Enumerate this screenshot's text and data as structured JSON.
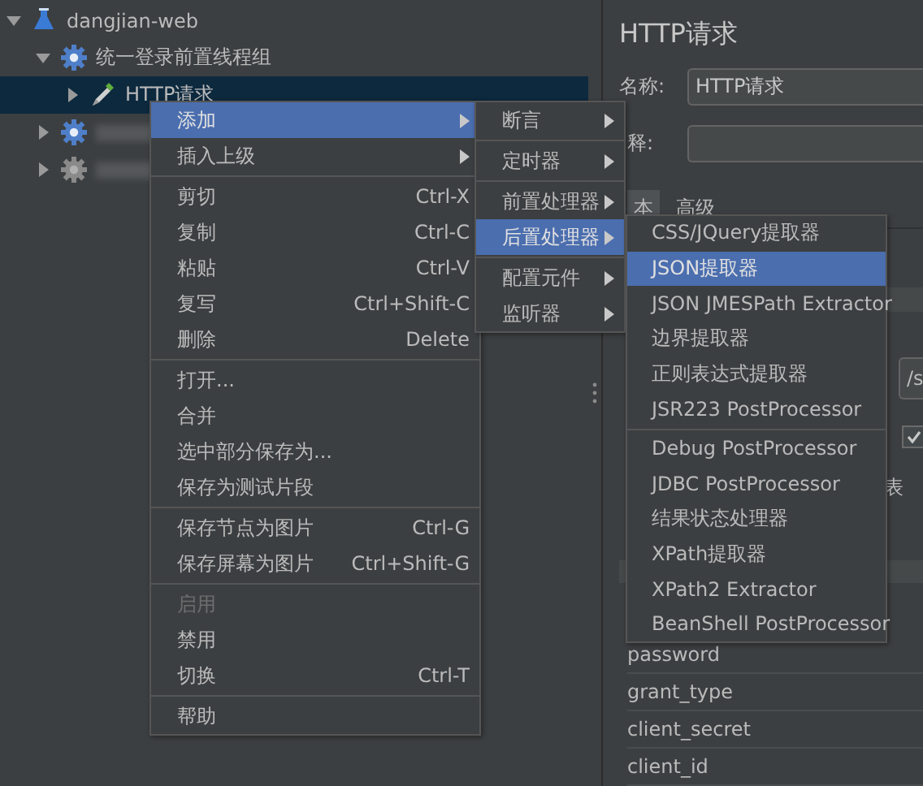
{
  "tree": [
    {
      "label": "dangjian-web",
      "kind": "test-plan",
      "expanded": true,
      "selected": false,
      "disabled": false,
      "children": [
        {
          "label": "统一登录前置线程组",
          "kind": "thread-group",
          "expanded": true,
          "selected": false,
          "disabled": false,
          "children": [
            {
              "label": "HTTP请求",
              "kind": "sampler",
              "expanded": false,
              "selected": true,
              "disabled": false
            }
          ]
        },
        {
          "kind": "thread-group",
          "expanded": false,
          "selected": false,
          "disabled": false,
          "redacted": true
        },
        {
          "kind": "thread-group",
          "expanded": false,
          "selected": false,
          "disabled": true,
          "redacted": true
        }
      ]
    }
  ],
  "panel": {
    "title": "HTTP请求",
    "name_label": "名称:",
    "name_value": "HTTP请求",
    "comment_label": "释:",
    "tabs": [
      {
        "label": "本",
        "selected": true
      },
      {
        "label": "高级",
        "selected": false
      }
    ],
    "path_value": "/s",
    "checkbox": {
      "checked": true
    },
    "side_text": "表",
    "parameters": [
      "password",
      "grant_type",
      "client_secret",
      "client_id"
    ]
  },
  "context_menu": {
    "items": [
      {
        "kind": "item",
        "label": "添加",
        "submenu": true,
        "selected": true,
        "disabled": false
      },
      {
        "kind": "item",
        "label": "插入上级",
        "submenu": true,
        "selected": false,
        "disabled": false
      },
      {
        "kind": "separator"
      },
      {
        "kind": "item",
        "label": "剪切",
        "shortcut": "Ctrl-X",
        "selected": false,
        "disabled": false
      },
      {
        "kind": "item",
        "label": "复制",
        "shortcut": "Ctrl-C",
        "selected": false,
        "disabled": false
      },
      {
        "kind": "item",
        "label": "粘贴",
        "shortcut": "Ctrl-V",
        "selected": false,
        "disabled": false
      },
      {
        "kind": "item",
        "label": "复写",
        "shortcut": "Ctrl+Shift-C",
        "selected": false,
        "disabled": false
      },
      {
        "kind": "item",
        "label": "删除",
        "shortcut": "Delete",
        "selected": false,
        "disabled": false
      },
      {
        "kind": "separator"
      },
      {
        "kind": "item",
        "label": "打开...",
        "selected": false,
        "disabled": false
      },
      {
        "kind": "item",
        "label": "合并",
        "selected": false,
        "disabled": false
      },
      {
        "kind": "item",
        "label": "选中部分保存为...",
        "selected": false,
        "disabled": false
      },
      {
        "kind": "item",
        "label": "保存为测试片段",
        "selected": false,
        "disabled": false
      },
      {
        "kind": "separator"
      },
      {
        "kind": "item",
        "label": "保存节点为图片",
        "shortcut": "Ctrl-G",
        "selected": false,
        "disabled": false
      },
      {
        "kind": "item",
        "label": "保存屏幕为图片",
        "shortcut": "Ctrl+Shift-G",
        "selected": false,
        "disabled": false
      },
      {
        "kind": "separator"
      },
      {
        "kind": "item",
        "label": "启用",
        "selected": false,
        "disabled": true
      },
      {
        "kind": "item",
        "label": "禁用",
        "selected": false,
        "disabled": false
      },
      {
        "kind": "item",
        "label": "切换",
        "shortcut": "Ctrl-T",
        "selected": false,
        "disabled": false
      },
      {
        "kind": "separator"
      },
      {
        "kind": "item",
        "label": "帮助",
        "selected": false,
        "disabled": false
      }
    ]
  },
  "add_submenu": {
    "items": [
      {
        "kind": "item",
        "label": "断言",
        "submenu": true,
        "selected": false,
        "disabled": false
      },
      {
        "kind": "separator"
      },
      {
        "kind": "item",
        "label": "定时器",
        "submenu": true,
        "selected": false,
        "disabled": false
      },
      {
        "kind": "separator"
      },
      {
        "kind": "item",
        "label": "前置处理器",
        "submenu": true,
        "selected": false,
        "disabled": false
      },
      {
        "kind": "item",
        "label": "后置处理器",
        "submenu": true,
        "selected": true,
        "disabled": false
      },
      {
        "kind": "separator"
      },
      {
        "kind": "item",
        "label": "配置元件",
        "submenu": true,
        "selected": false,
        "disabled": false
      },
      {
        "kind": "item",
        "label": "监听器",
        "submenu": true,
        "selected": false,
        "disabled": false
      }
    ]
  },
  "post_processor_submenu": {
    "items": [
      {
        "kind": "item",
        "label": "CSS/JQuery提取器",
        "selected": false,
        "disabled": false
      },
      {
        "kind": "item",
        "label": "JSON提取器",
        "selected": true,
        "disabled": false
      },
      {
        "kind": "item",
        "label": "JSON JMESPath Extractor",
        "selected": false,
        "disabled": false
      },
      {
        "kind": "item",
        "label": "边界提取器",
        "selected": false,
        "disabled": false
      },
      {
        "kind": "item",
        "label": "正则表达式提取器",
        "selected": false,
        "disabled": false
      },
      {
        "kind": "item",
        "label": "JSR223 PostProcessor",
        "selected": false,
        "disabled": false
      },
      {
        "kind": "separator"
      },
      {
        "kind": "item",
        "label": "Debug PostProcessor",
        "selected": false,
        "disabled": false
      },
      {
        "kind": "item",
        "label": "JDBC PostProcessor",
        "selected": false,
        "disabled": false
      },
      {
        "kind": "item",
        "label": "结果状态处理器",
        "selected": false,
        "disabled": false
      },
      {
        "kind": "item",
        "label": "XPath提取器",
        "selected": false,
        "disabled": false
      },
      {
        "kind": "item",
        "label": "XPath2 Extractor",
        "selected": false,
        "disabled": false
      },
      {
        "kind": "item",
        "label": "BeanShell PostProcessor",
        "selected": false,
        "disabled": false
      }
    ]
  }
}
